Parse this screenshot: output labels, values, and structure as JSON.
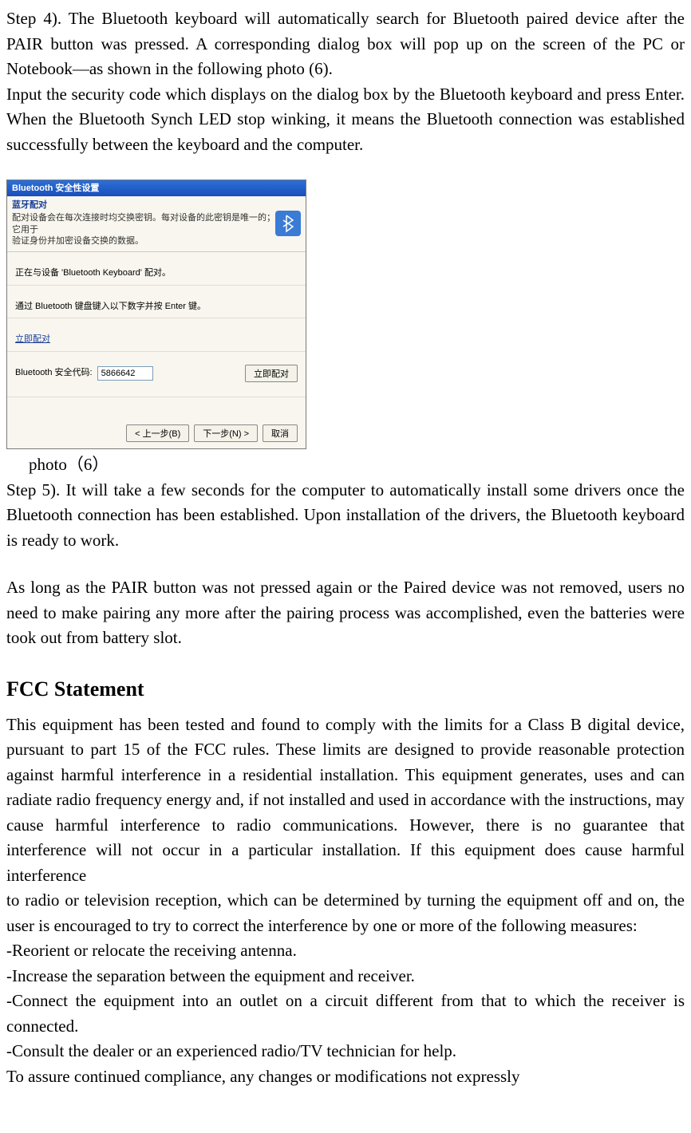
{
  "step4": {
    "p1": "Step 4). The Bluetooth keyboard will automatically search for Bluetooth paired device after the PAIR button was pressed. A corresponding dialog box will pop up on the screen of the PC or Notebook—as shown in the following photo (6).",
    "p2": "Input the security code which displays on the dialog box by the Bluetooth keyboard and press Enter. When the Bluetooth Synch LED stop winking, it means the Bluetooth connection was established successfully between the keyboard and the computer."
  },
  "dialog": {
    "title": "Bluetooth 安全性设置",
    "headerTitle": "蓝牙配对",
    "headerDesc1": "配对设备会在每次连接时均交换密钥。每对设备的此密钥是唯一的；它用于",
    "headerDesc2": "验证身份并加密设备交换的数据。",
    "pairing": "正在与设备 'Bluetooth Keyboard' 配对。",
    "instruction": "通过 Bluetooth 键盘键入以下数字并按 Enter 键。",
    "pairNow": "立即配对",
    "codeLabel": "Bluetooth 安全代码:",
    "code": "5866642",
    "pairBtn": "立即配对",
    "back": "< 上一步(B)",
    "next": "下一步(N) >",
    "cancel": "取消"
  },
  "caption": "photo（6）",
  "step5": {
    "p1": "Step 5). It will take a few seconds for the computer to automatically install some drivers once the Bluetooth connection has been established. Upon installation of the drivers, the Bluetooth keyboard is ready to work.",
    "p2": "As long as the PAIR button was not pressed again or the Paired device was not removed,  users no need to make pairing any more after the pairing process was accomplished, even the batteries were took out from battery slot."
  },
  "fcc": {
    "title": "FCC Statement",
    "p1": "This equipment has been tested and found to comply with the limits for a Class B digital device, pursuant to part 15 of the FCC rules. These limits are designed to provide reasonable protection against harmful interference in a residential installation. This equipment generates, uses and can radiate radio frequency energy and, if not installed and used in accordance with the instructions, may cause harmful interference to radio communications. However, there is no guarantee that interference will not occur in a particular installation. If this equipment does cause harmful interference",
    "p2": "to radio or television reception, which can be determined by turning the equipment off and on, the user is encouraged to try to correct the interference by one or more of the following measures:",
    "m1": "-Reorient or relocate the receiving antenna.",
    "m2": "-Increase the separation between the equipment and receiver.",
    "m3": "-Connect the equipment into an outlet on a circuit different from that to which the receiver is connected.",
    "m4": "-Consult the dealer or an experienced radio/TV technician for help.",
    "p3": "To assure continued compliance, any changes or modifications not expressly"
  }
}
